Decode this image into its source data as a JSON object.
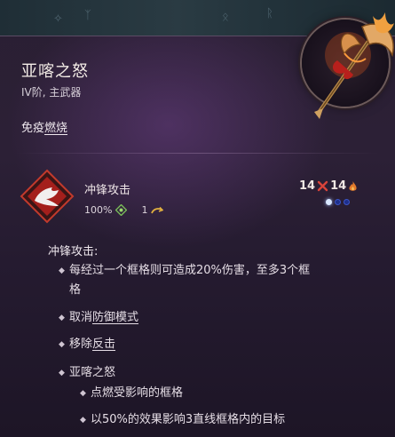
{
  "item": {
    "name": "亚喀之怒",
    "subtitle": "IV阶, 主武器",
    "immunity_prefix": "免疫",
    "immunity_link": "燃烧"
  },
  "action": {
    "name": "冲锋攻击",
    "cost_value": "100%",
    "count": "1",
    "damage_left": "14",
    "damage_right": "14"
  },
  "description": {
    "heading": "冲锋攻击:",
    "line1": "每经过一个框格则可造成20%伤害，至多3个框",
    "line1_cont": "格",
    "line2_prefix": "取消",
    "line2_link": "防御模式",
    "line3_prefix": "移除",
    "line3_link": "反击",
    "line4": "亚喀之怒",
    "sub1": "点燃受影响的框格",
    "sub2": "以50%的效果影响3直线框格内的目标"
  },
  "colors": {
    "dot_active": "#d9e8ff",
    "dot_inactive": "#1e2f8a",
    "accent_fire": "#e27a2c"
  },
  "icons": [
    "weapon-axe-icon",
    "charge-attack-icon",
    "ap-cost-icon",
    "turn-arrow-icon",
    "damage-cross-icon",
    "fire-icon",
    "bullet-diamond-icon"
  ]
}
